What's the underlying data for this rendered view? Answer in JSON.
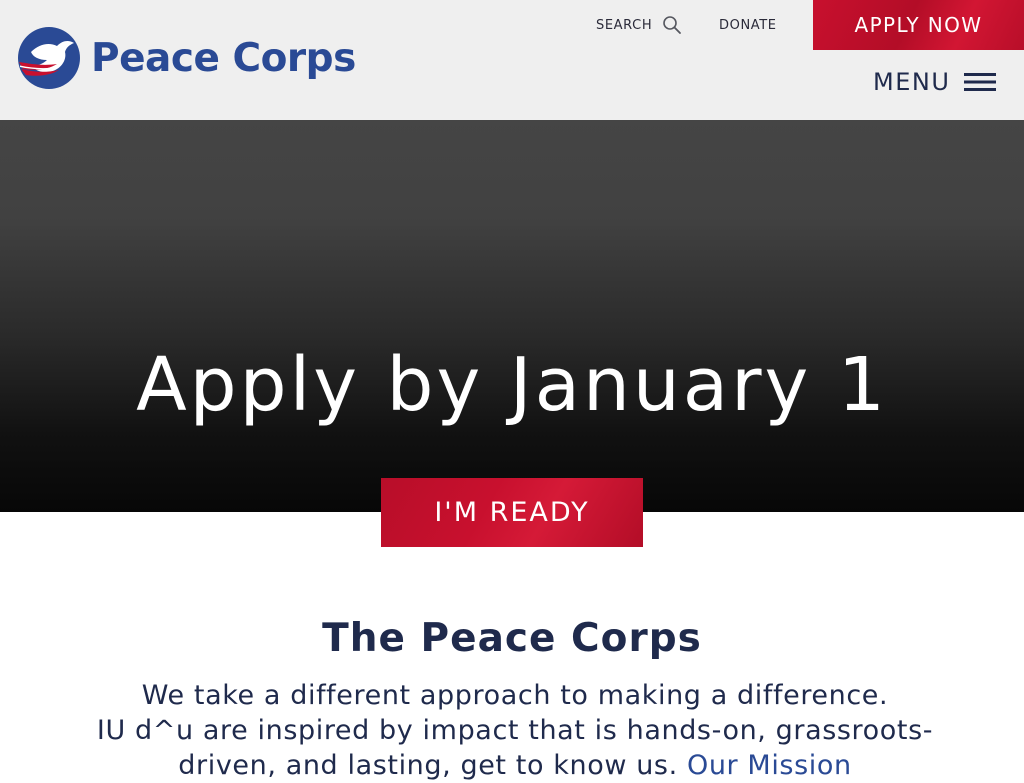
{
  "header": {
    "brand": "Peace Corps",
    "search_label": "SEARCH",
    "donate_label": "DONATE",
    "apply_label": "APPLY NOW",
    "menu_label": "MENU"
  },
  "hero": {
    "title": "Apply by January 1",
    "cta_label": "I'M READY"
  },
  "intro": {
    "heading": "The Peace Corps",
    "line_1": "We take a different approach to making a difference.",
    "line_2": "IU d^u are inspired by impact that is hands-on, grassroots-driven, and lasting, get to know us.",
    "link_label": "Our Mission"
  },
  "colors": {
    "brand_blue": "#2a4a95",
    "brand_red": "#c8102e",
    "navy_text": "#1f2a4c",
    "header_bg": "#efefef"
  },
  "icons": {
    "logo": "dove-logo-icon",
    "search": "search-icon",
    "menu": "hamburger-menu-icon"
  }
}
